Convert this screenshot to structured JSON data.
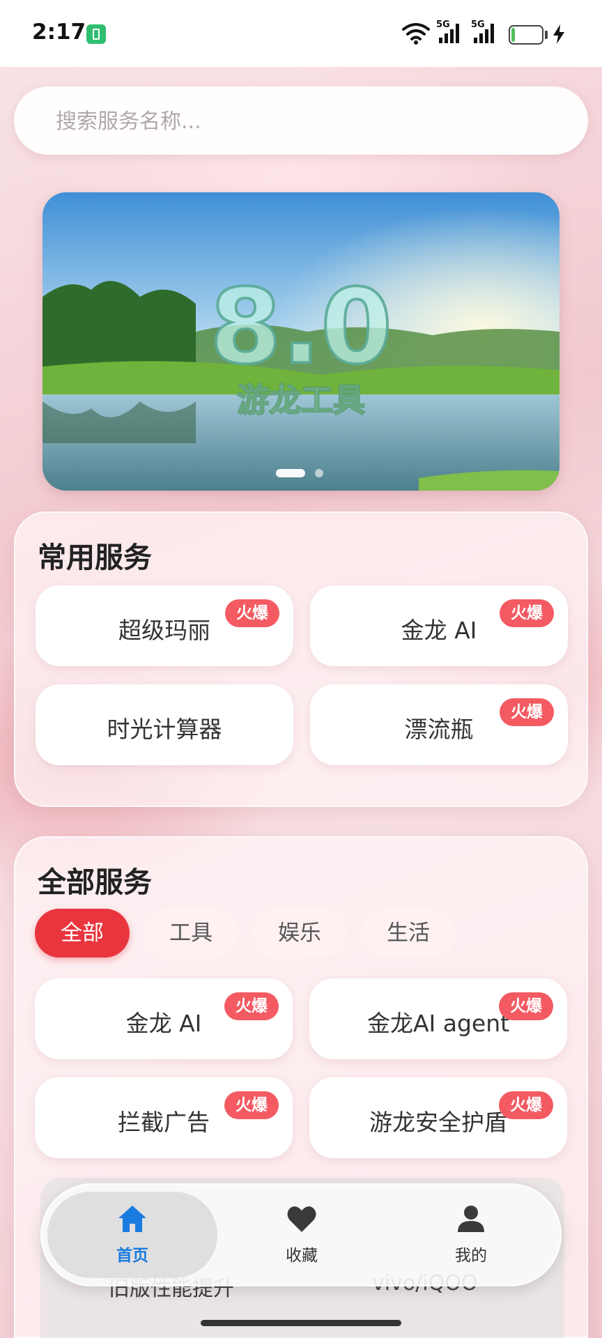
{
  "status_bar": {
    "time": "2:17",
    "network_1": "5G",
    "network_2": "5G",
    "battery": "12",
    "battery_level_percent": 12,
    "icons": [
      "sim-card-icon",
      "wifi-icon",
      "signal-icon",
      "signal-icon",
      "battery-icon",
      "charging-bolt-icon"
    ]
  },
  "search": {
    "placeholder": "搜索服务名称..."
  },
  "banner": {
    "big_text": "8.0",
    "caption": "游龙工具",
    "page_count": 2,
    "active_page": 1
  },
  "common_services": {
    "title": "常用服务",
    "items": [
      {
        "label": "超级玛丽",
        "badge": "火爆"
      },
      {
        "label": "金龙 AI",
        "badge": "火爆"
      },
      {
        "label": "时光计算器",
        "badge": ""
      },
      {
        "label": "漂流瓶",
        "badge": "火爆"
      }
    ]
  },
  "all_services": {
    "title": "全部服务",
    "filters": [
      "全部",
      "工具",
      "娱乐",
      "生活"
    ],
    "active_filter": "全部",
    "items": [
      {
        "label": "金龙 AI",
        "badge": "火爆"
      },
      {
        "label": "金龙AI agent",
        "badge": "火爆"
      },
      {
        "label": "拦截广告",
        "badge": "火爆"
      },
      {
        "label": "游龙安全护盾",
        "badge": "火爆"
      }
    ],
    "peek_items": [
      "旧版性能提升",
      "vivo/iQOO"
    ]
  },
  "bottom_nav": {
    "items": [
      {
        "label": "首页",
        "icon": "home-icon",
        "active": true
      },
      {
        "label": "收藏",
        "icon": "heart-icon",
        "active": false
      },
      {
        "label": "我的",
        "icon": "user-icon",
        "active": false
      }
    ]
  },
  "colors": {
    "accent_red": "#e8353e",
    "badge_red": "#f35a62",
    "nav_active_blue": "#1a7be0",
    "background_pink": "#f2c9cf"
  }
}
